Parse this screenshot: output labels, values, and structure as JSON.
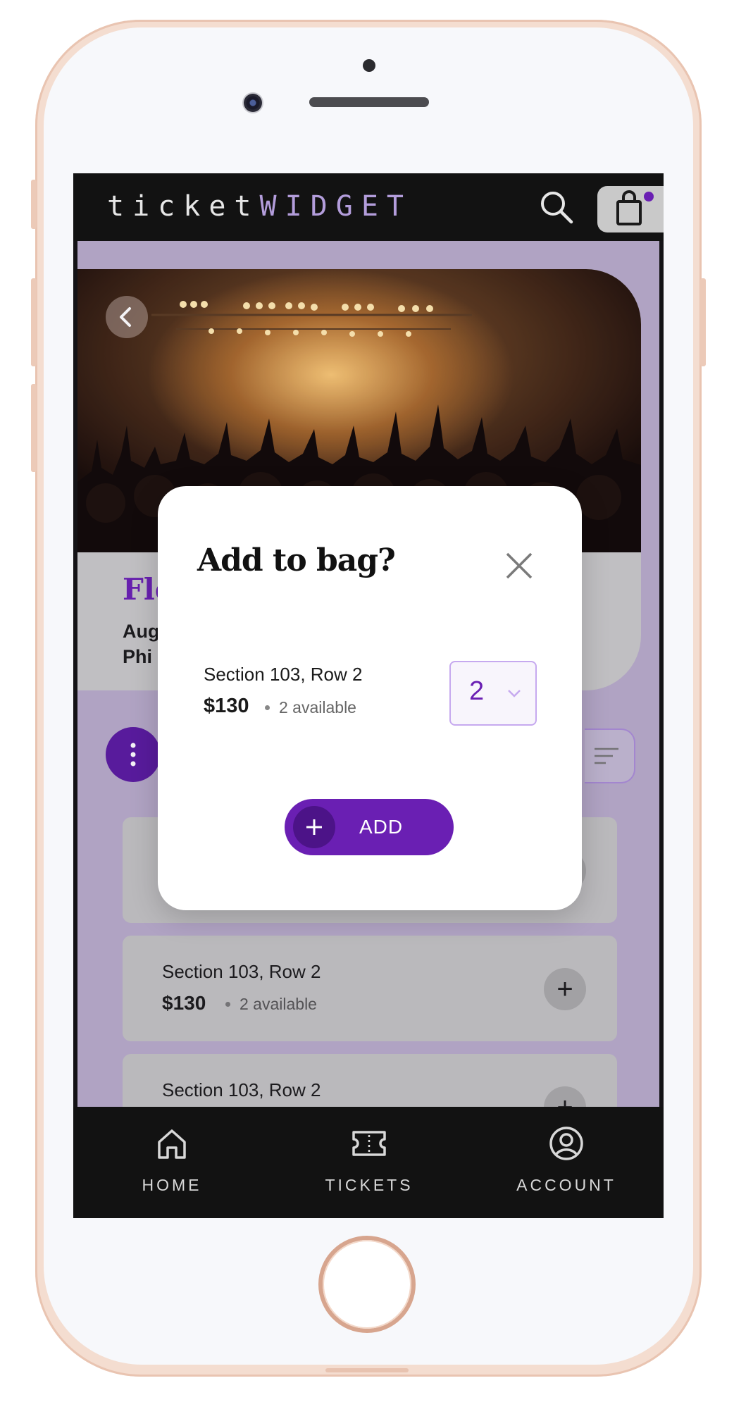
{
  "app": {
    "logo_part1": "ticket",
    "logo_part2": "WIDGET"
  },
  "event": {
    "title_partial": "Fle",
    "line1_partial": "Aug",
    "line2_partial": "Phi"
  },
  "tickets": [
    {
      "section": "",
      "price": "",
      "available": ""
    },
    {
      "section": "Section 103, Row 2",
      "price": "$130",
      "available": "2 available"
    },
    {
      "section": "Section 103, Row 2",
      "price": "",
      "available": ""
    }
  ],
  "modal": {
    "title": "Add to bag?",
    "section": "Section 103, Row 2",
    "price": "$130",
    "available": "2 available",
    "quantity": "2",
    "add_label": "ADD"
  },
  "nav": {
    "home": "HOME",
    "tickets": "TICKETS",
    "account": "ACCOUNT"
  },
  "colors": {
    "accent": "#6a1fb3",
    "accent_dark": "#4c1388",
    "dark_bg": "#121212",
    "lavender_bg": "#b7abc9"
  },
  "icons": [
    "search-icon",
    "shopping-bag-icon",
    "back-chevron-icon",
    "more-vertical-icon",
    "filter-icon",
    "plus-icon",
    "close-icon",
    "chevron-down-icon",
    "home-icon",
    "ticket-icon",
    "account-icon"
  ]
}
